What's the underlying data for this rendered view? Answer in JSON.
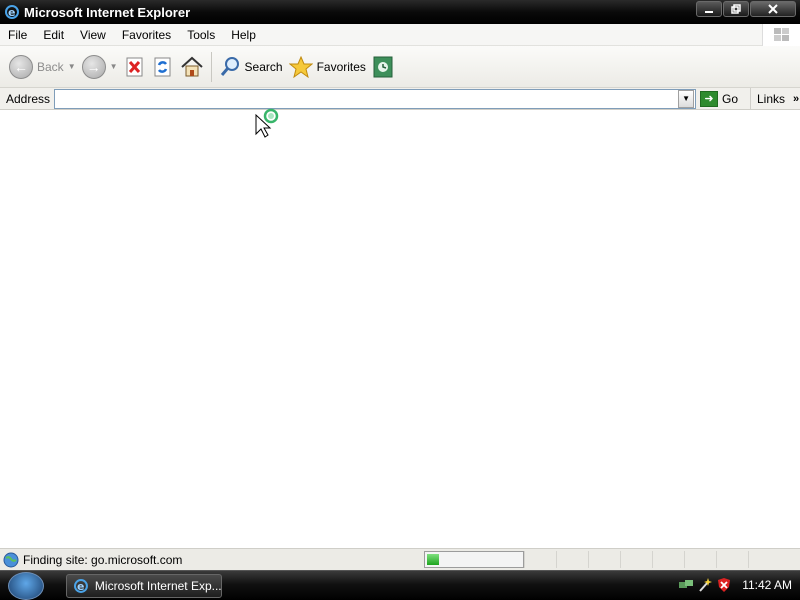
{
  "window": {
    "title": "Microsoft Internet Explorer",
    "app_icon": "ie-icon",
    "buttons": [
      "minimize",
      "restore",
      "close"
    ]
  },
  "menu": {
    "items": [
      "File",
      "Edit",
      "View",
      "Favorites",
      "Tools",
      "Help"
    ],
    "logo": "windows-flag-icon"
  },
  "toolbar": {
    "back_label": "Back",
    "search_label": "Search",
    "favorites_label": "Favorites",
    "icons": [
      "back-icon",
      "forward-icon",
      "stop-icon",
      "refresh-icon",
      "home-icon",
      "search-icon",
      "favorites-star-icon",
      "media-icon"
    ]
  },
  "address": {
    "label": "Address",
    "value": "",
    "go_label": "Go",
    "links_label": "Links"
  },
  "status": {
    "text": "Finding site: go.microsoft.com",
    "progress": 0.12
  },
  "taskbar": {
    "task_label": "Microsoft Internet Exp...",
    "clock": "11:42 AM"
  }
}
